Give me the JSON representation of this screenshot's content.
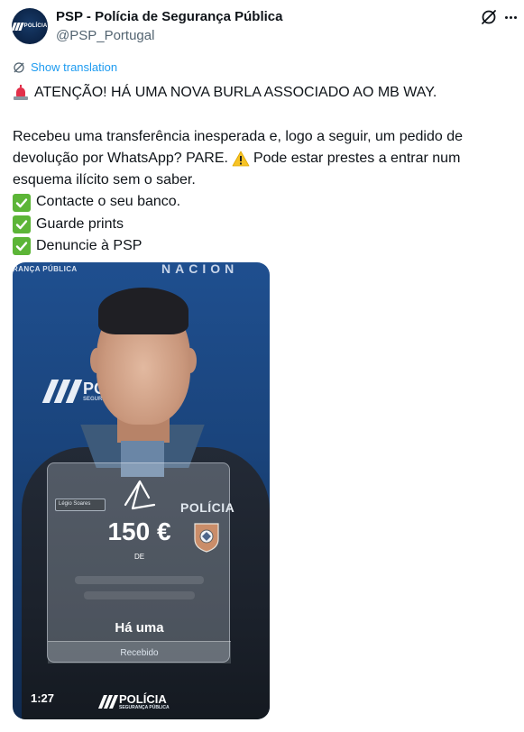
{
  "author": {
    "display_name": "PSP - Polícia de Segurança Pública",
    "handle": "@PSP_Portugal"
  },
  "translate_label": "Show translation",
  "tweet": {
    "line1": "ATENÇÃO! HÁ UMA NOVA BURLA ASSOCIADO AO MB WAY.",
    "line2": "Recebeu uma transferência inesperada e, logo a seguir, um pedido de",
    "line3a": "devolução por WhatsApp? PARE.",
    "line3b": "Pode estar prestes a entrar num",
    "line4": "esquema ilícito sem o saber.",
    "checks": [
      "Contacte o seu banco.",
      "Guarde prints",
      "Denuncie à PSP"
    ]
  },
  "video": {
    "duration": "1:27",
    "wall_text_left": "RANÇA PÚBLICA",
    "wall_text_right": "NACION",
    "wall_logo_text": "POLÍCIA",
    "wall_logo_sub": "SEGURANÇA PÚBLICA",
    "name_tag": "Légio Soares",
    "jacket_text": "POLÍCIA",
    "overlay": {
      "amount": "150 €",
      "de_label": "DE",
      "title": "Há uma",
      "status": "Recebido"
    },
    "bottom_logo_text": "POLÍCIA",
    "bottom_logo_sub": "SEGURANÇA PÚBLICA"
  },
  "icons": {
    "header_action": "grok-icon",
    "more": "more-icon",
    "translate": "translate-icon",
    "siren": "siren-emoji",
    "warning": "warning-emoji",
    "check": "check-emoji"
  },
  "colors": {
    "link": "#1d9bf0",
    "secondary_text": "#536471",
    "primary_text": "#0f1419",
    "check_green": "#5cb537",
    "video_blue": "#1f4f8f"
  }
}
